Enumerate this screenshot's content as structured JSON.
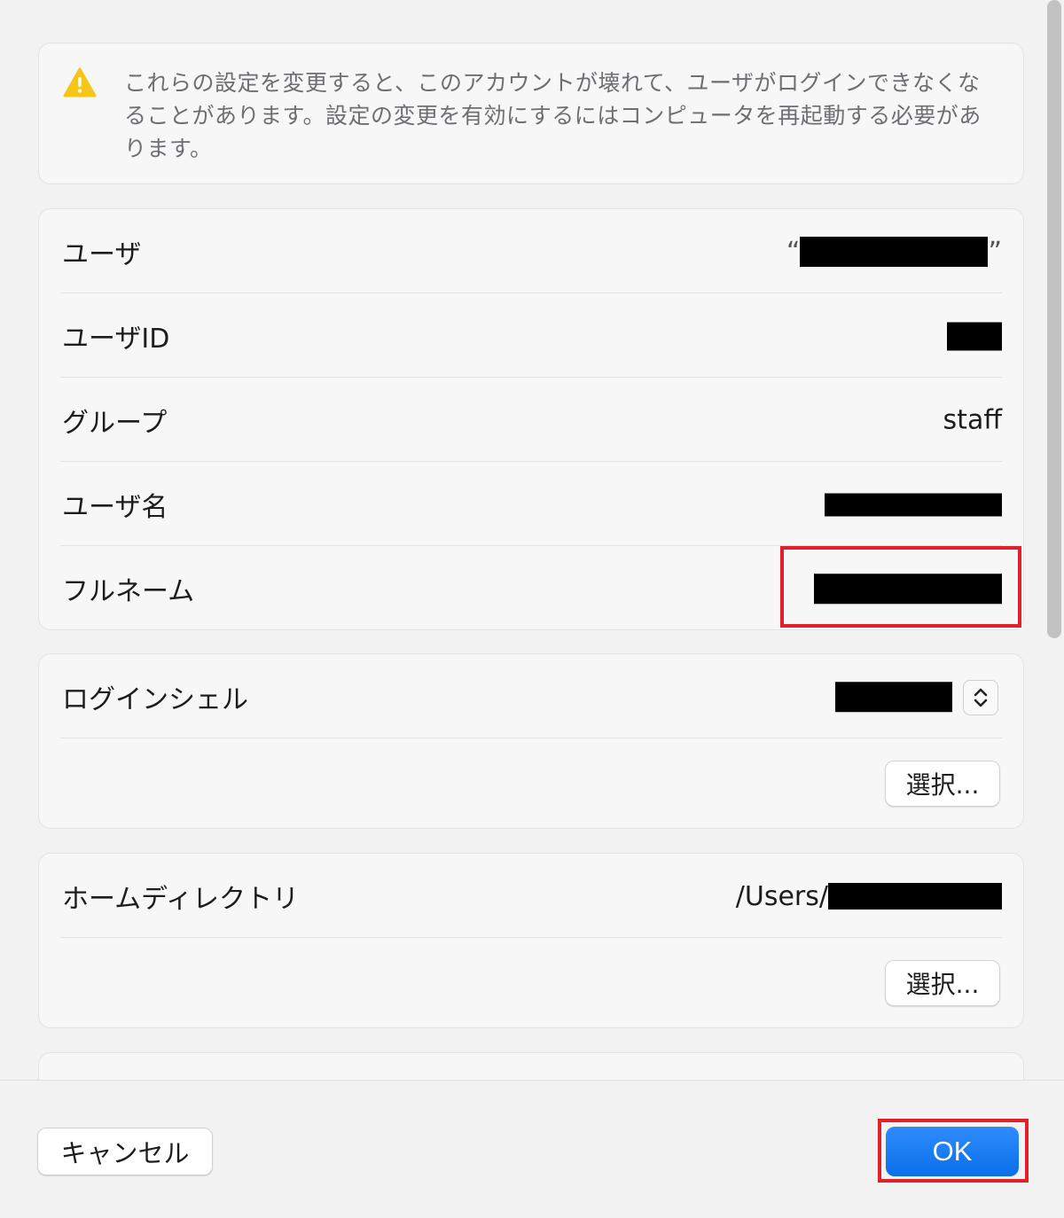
{
  "warning": {
    "icon": "warning-triangle-icon",
    "text": "これらの設定を変更すると、このアカウントが壊れて、ユーザがログインできなくなることがあります。設定の変更を有効にするにはコンピュータを再起動する必要があります。"
  },
  "info": {
    "rows": [
      {
        "label": "ユーザ",
        "value": "[redacted]"
      },
      {
        "label": "ユーザID",
        "value": "[redacted]"
      },
      {
        "label": "グループ",
        "value": "staff"
      },
      {
        "label": "ユーザ名",
        "value": "[redacted]"
      },
      {
        "label": "フルネーム",
        "value": "[redacted]"
      }
    ]
  },
  "shell": {
    "label": "ログインシェル",
    "value": "[redacted]",
    "choose_label": "選択..."
  },
  "home": {
    "label": "ホームディレクトリ",
    "value_prefix": "/Users/",
    "value": "[redacted]",
    "choose_label": "選択..."
  },
  "footer": {
    "cancel_label": "キャンセル",
    "ok_label": "OK"
  },
  "colors": {
    "highlight": "#e0202a",
    "accent": "#0a6fe8",
    "warning": "#f5c518"
  }
}
